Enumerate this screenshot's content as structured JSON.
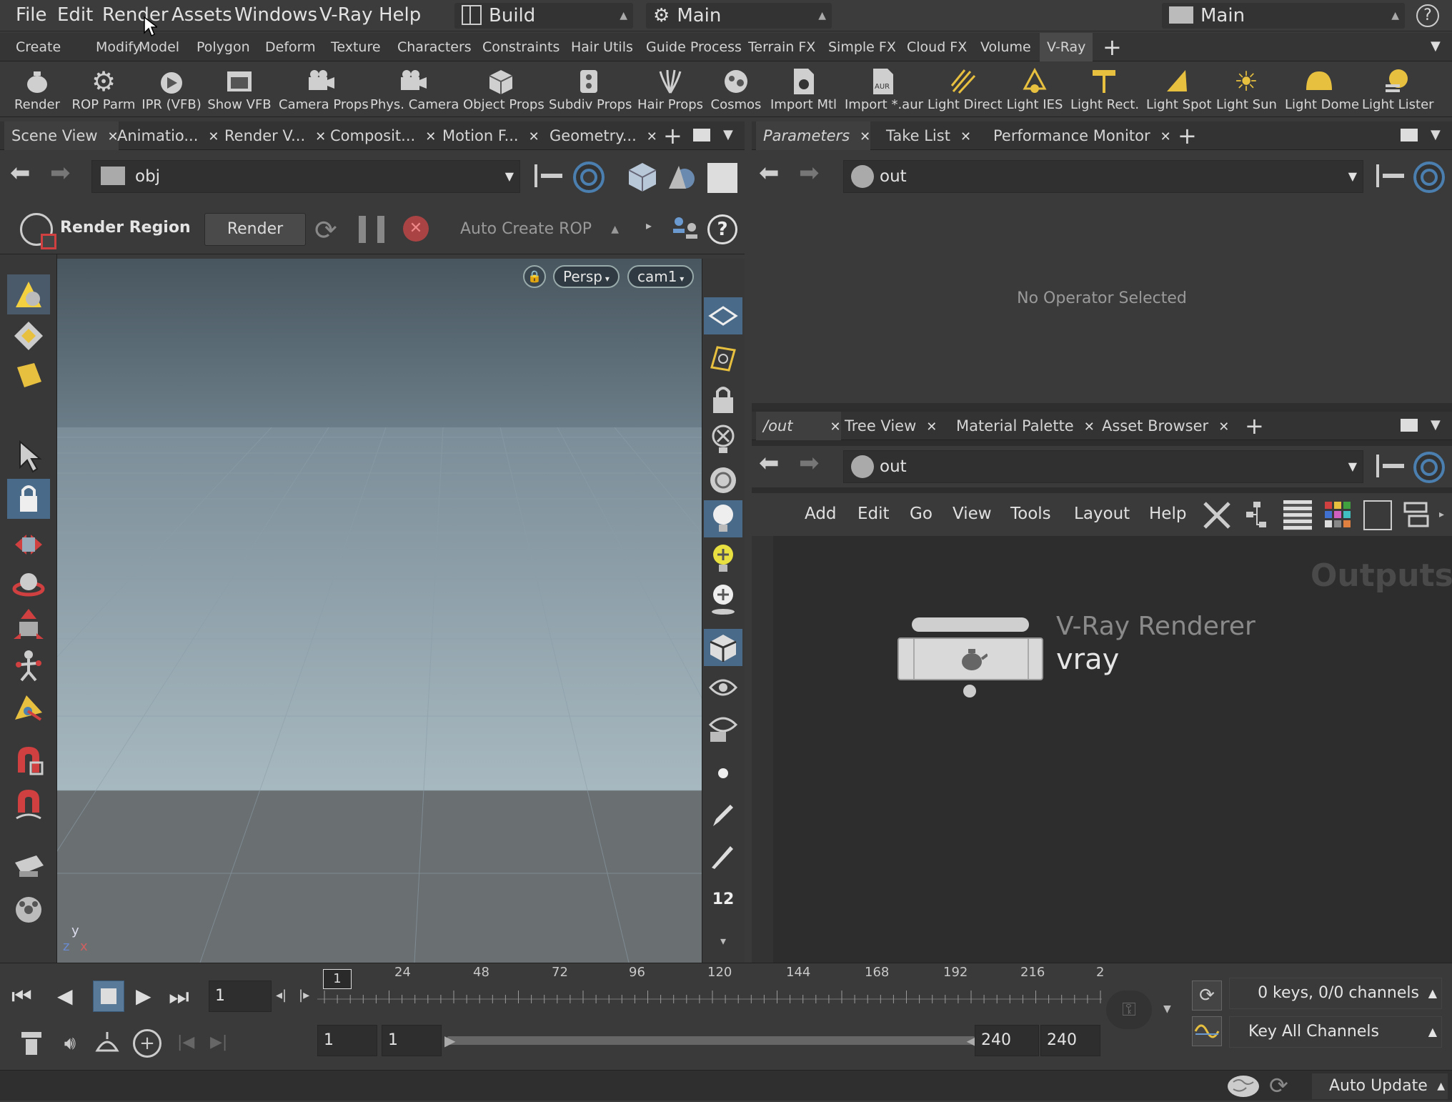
{
  "menubar": {
    "items": [
      "File",
      "Edit",
      "Render",
      "Assets",
      "Windows",
      "V-Ray",
      "Help"
    ],
    "desktop_combo": "Build",
    "context_combo": "Main",
    "scene_combo": "Main",
    "help_icon": "question-mark-icon"
  },
  "shelf_tabs": [
    "Create",
    "Modify",
    "Model",
    "Polygon",
    "Deform",
    "Texture",
    "Characters",
    "Constraints",
    "Hair Utils",
    "Guide Process",
    "Terrain FX",
    "Simple FX",
    "Cloud FX",
    "Volume",
    "V-Ray"
  ],
  "shelf_active_tab": "V-Ray",
  "shelf_tools": [
    "Render",
    "ROP Parm",
    "IPR (VFB)",
    "Show VFB",
    "Camera Props",
    "Phys. Camera",
    "Object Props",
    "Subdiv Props",
    "Hair Props",
    "Cosmos",
    "Import Mtl",
    "Import *.aur",
    "Light Direct",
    "Light IES",
    "Light Rect.",
    "Light Spot",
    "Light Sun",
    "Light Dome",
    "Light Lister"
  ],
  "left_pane": {
    "tabs": [
      "Scene View",
      "Animatio...",
      "Render V...",
      "Composit...",
      "Motion F...",
      "Geometry..."
    ],
    "path": "obj",
    "render_region_label": "Render Region",
    "render_button": "Render",
    "auto_create_rop": "Auto Create ROP",
    "persp_label": "Persp",
    "camera_label": "cam1",
    "axis_y": "y",
    "axis_z": "z",
    "axis_x": "x",
    "display_count": "12"
  },
  "params_pane": {
    "tabs": [
      "Parameters",
      "Take List",
      "Performance Monitor"
    ],
    "path": "out",
    "empty_message": "No Operator Selected"
  },
  "network_pane": {
    "tabs": [
      "/out",
      "Tree View",
      "Material Palette",
      "Asset Browser"
    ],
    "path": "out",
    "menu": [
      "Add",
      "Edit",
      "Go",
      "View",
      "Tools",
      "Layout",
      "Help"
    ],
    "context_label": "Outputs",
    "node_type": "V-Ray Renderer",
    "node_name": "vray"
  },
  "timeline": {
    "current_frame": "1",
    "frame_marker": "1",
    "tick_labels": [
      "24",
      "48",
      "72",
      "96",
      "120",
      "144",
      "168",
      "192",
      "216",
      "2"
    ],
    "range_start": "1",
    "range_start2": "1",
    "range_end": "240",
    "range_end2": "240",
    "keys_info": "0 keys, 0/0 channels",
    "key_channels": "Key All Channels"
  },
  "statusbar": {
    "update_mode": "Auto Update"
  },
  "colors": {
    "accent_blue": "#4a7fb0",
    "viewport_sky_top": "#4a5a64",
    "viewport_ground": "#9aabb3",
    "node_color": "#d9d9d9"
  }
}
